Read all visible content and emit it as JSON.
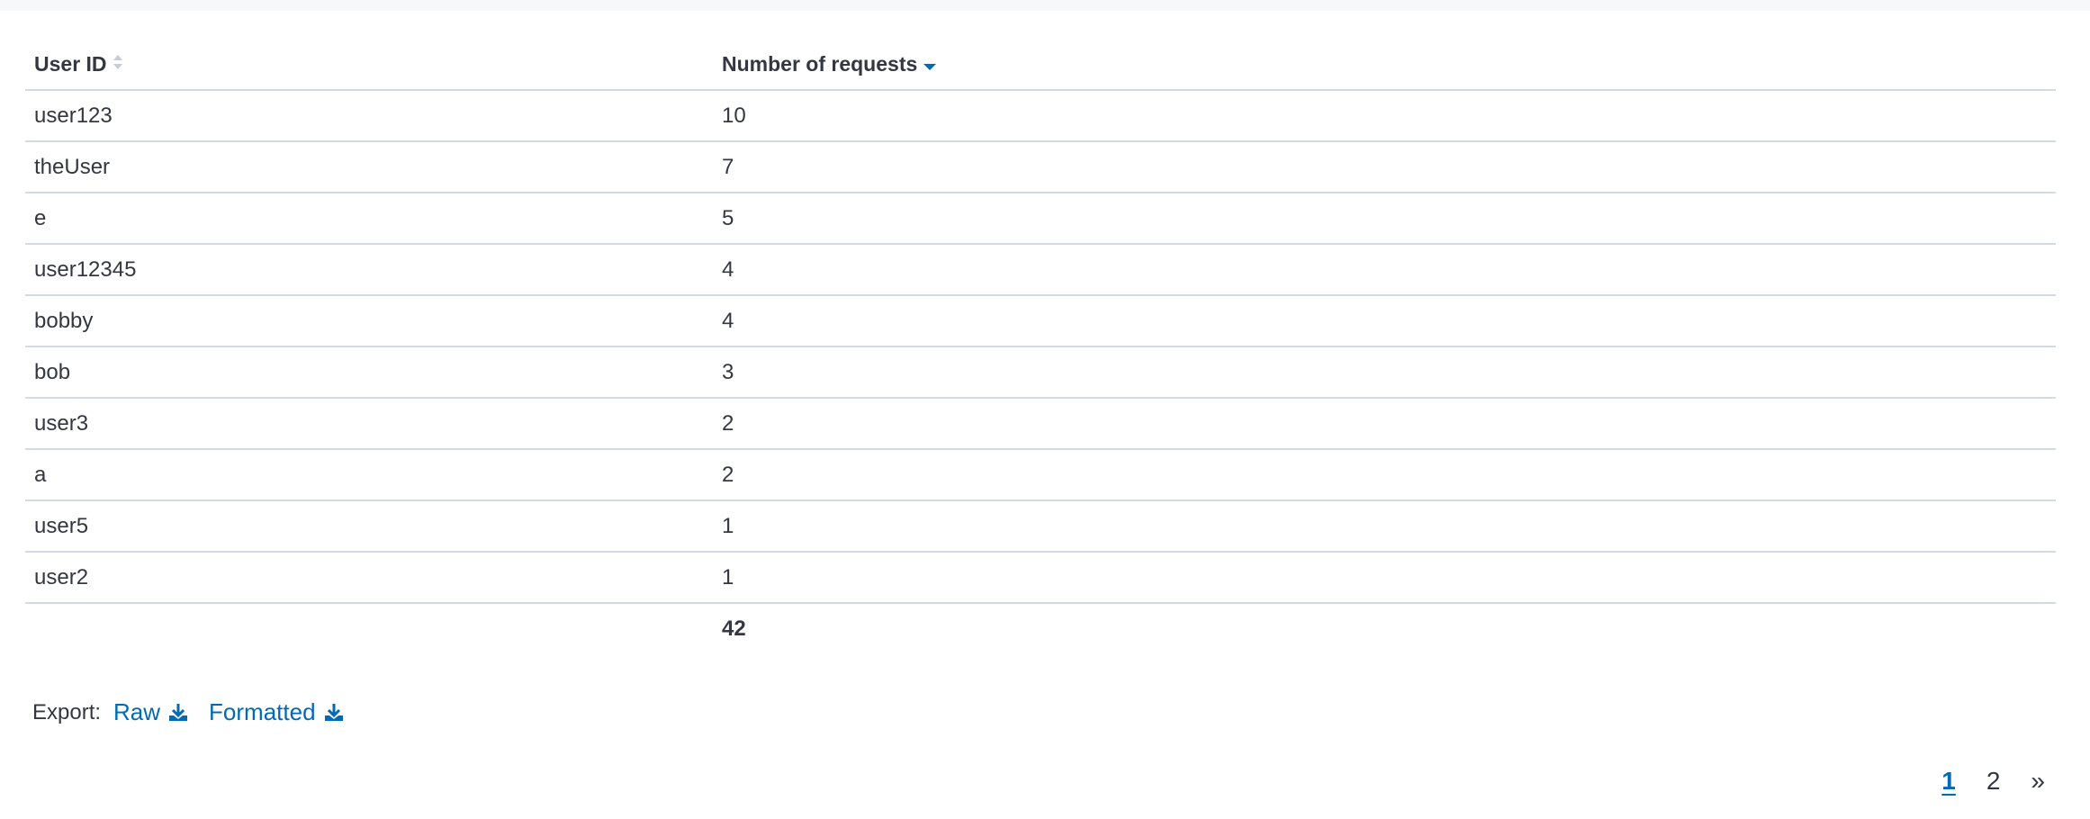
{
  "table": {
    "columns": [
      {
        "label": "User ID",
        "sort": "none"
      },
      {
        "label": "Number of requests",
        "sort": "descending"
      }
    ],
    "rows": [
      {
        "user_id": "user123",
        "requests": "10"
      },
      {
        "user_id": "theUser",
        "requests": "7"
      },
      {
        "user_id": "e",
        "requests": "5"
      },
      {
        "user_id": "user12345",
        "requests": "4"
      },
      {
        "user_id": "bobby",
        "requests": "4"
      },
      {
        "user_id": "bob",
        "requests": "3"
      },
      {
        "user_id": "user3",
        "requests": "2"
      },
      {
        "user_id": "a",
        "requests": "2"
      },
      {
        "user_id": "user5",
        "requests": "1"
      },
      {
        "user_id": "user2",
        "requests": "1"
      }
    ],
    "total": "42"
  },
  "export": {
    "label": "Export:",
    "raw_label": "Raw",
    "formatted_label": "Formatted",
    "icon": "download-icon"
  },
  "pagination": {
    "pages": [
      "1",
      "2"
    ],
    "current": "1",
    "next_label": "»"
  },
  "colors": {
    "accent": "#006bb4",
    "text": "#343741",
    "border": "#d3dae6",
    "sort_inactive": "#c5ccd6"
  }
}
